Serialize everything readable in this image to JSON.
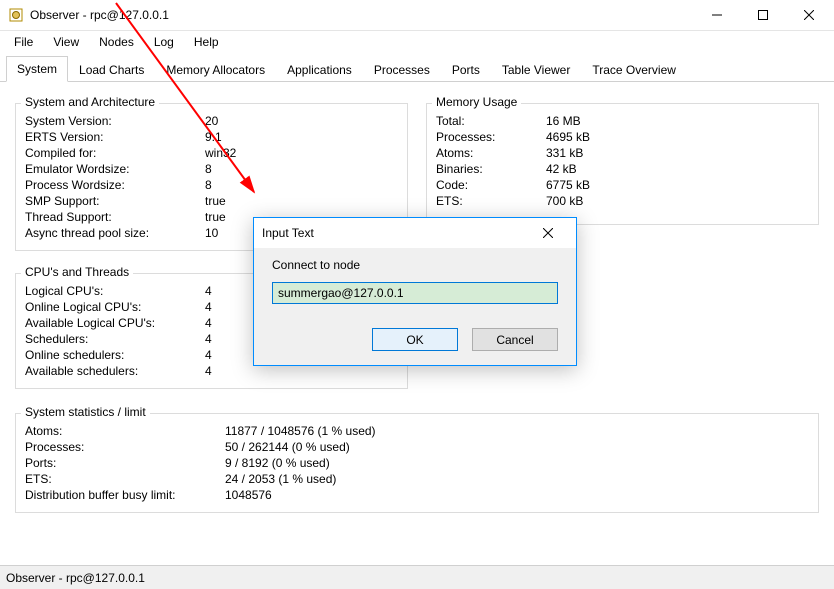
{
  "window": {
    "title": "Observer - rpc@127.0.0.1"
  },
  "menu": {
    "file": "File",
    "view": "View",
    "nodes": "Nodes",
    "log": "Log",
    "help": "Help"
  },
  "tabs": {
    "system": "System",
    "load_charts": "Load Charts",
    "memory_allocators": "Memory Allocators",
    "applications": "Applications",
    "processes": "Processes",
    "ports": "Ports",
    "table_viewer": "Table Viewer",
    "trace_overview": "Trace Overview"
  },
  "system_arch": {
    "title": "System and Architecture",
    "items": [
      {
        "k": "System Version:",
        "v": "20"
      },
      {
        "k": "ERTS Version:",
        "v": "9.1"
      },
      {
        "k": "Compiled for:",
        "v": "win32"
      },
      {
        "k": "Emulator Wordsize:",
        "v": "8"
      },
      {
        "k": "Process Wordsize:",
        "v": "8"
      },
      {
        "k": "SMP Support:",
        "v": "true"
      },
      {
        "k": "Thread Support:",
        "v": "true"
      },
      {
        "k": "Async thread pool size:",
        "v": "10"
      }
    ]
  },
  "memory_usage": {
    "title": "Memory Usage",
    "items": [
      {
        "k": "Total:",
        "v": "16 MB"
      },
      {
        "k": "Processes:",
        "v": "4695 kB"
      },
      {
        "k": "Atoms:",
        "v": "331 kB"
      },
      {
        "k": "Binaries:",
        "v": "42 kB"
      },
      {
        "k": "Code:",
        "v": "6775 kB"
      },
      {
        "k": "ETS:",
        "v": "700 kB"
      }
    ]
  },
  "cpus": {
    "title": "CPU's and Threads",
    "items": [
      {
        "k": "Logical CPU's:",
        "v": "4"
      },
      {
        "k": "Online Logical CPU's:",
        "v": "4"
      },
      {
        "k": "Available Logical CPU's:",
        "v": "4"
      },
      {
        "k": "Schedulers:",
        "v": "4"
      },
      {
        "k": "Online schedulers:",
        "v": "4"
      },
      {
        "k": "Available schedulers:",
        "v": "4"
      }
    ]
  },
  "stats": {
    "title": "System statistics / limit",
    "items": [
      {
        "k": "Atoms:",
        "v": "11877 / 1048576 (1 % used)"
      },
      {
        "k": "Processes:",
        "v": "50 / 262144 (0 % used)"
      },
      {
        "k": "Ports:",
        "v": "9 / 8192 (0 % used)"
      },
      {
        "k": "ETS:",
        "v": "24 / 2053 (1 % used)"
      },
      {
        "k": "Distribution buffer busy limit:",
        "v": "1048576"
      }
    ]
  },
  "dialog": {
    "title": "Input Text",
    "label": "Connect to node",
    "value": "summergao@127.0.0.1",
    "ok": "OK",
    "cancel": "Cancel"
  },
  "status": {
    "text": "Observer - rpc@127.0.0.1"
  }
}
